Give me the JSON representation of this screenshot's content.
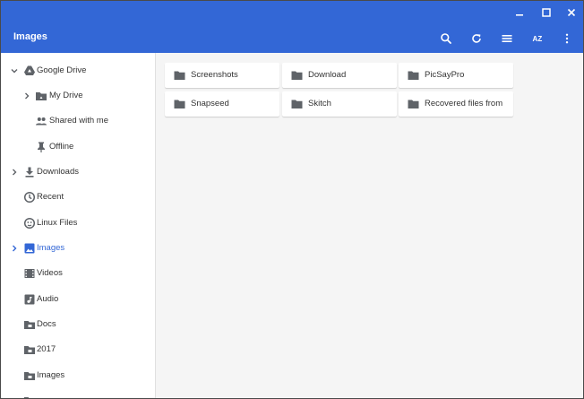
{
  "window": {
    "controls": [
      "minimize-icon",
      "maximize-icon",
      "close-icon"
    ]
  },
  "appbar": {
    "title": "Images",
    "tools": [
      "search-icon",
      "refresh-icon",
      "list-view-icon",
      "sort-az-icon",
      "more-vert-icon"
    ],
    "sort_label": "AZ"
  },
  "sidebar": {
    "items": [
      {
        "label": "Google Drive",
        "icon": "google-drive-icon",
        "chevron": "down"
      },
      {
        "label": "My Drive",
        "icon": "my-drive-icon",
        "chevron": "right"
      },
      {
        "label": "Shared with me",
        "icon": "shared-people-icon",
        "chevron": ""
      },
      {
        "label": "Offline",
        "icon": "pin-icon",
        "chevron": ""
      },
      {
        "label": "Downloads",
        "icon": "download-icon",
        "chevron": "right"
      },
      {
        "label": "Recent",
        "icon": "clock-icon",
        "chevron": ""
      },
      {
        "label": "Linux Files",
        "icon": "linux-icon",
        "chevron": ""
      },
      {
        "label": "Images",
        "icon": "image-icon",
        "chevron": "right",
        "active": true
      },
      {
        "label": "Videos",
        "icon": "video-icon",
        "chevron": ""
      },
      {
        "label": "Audio",
        "icon": "audio-icon",
        "chevron": ""
      },
      {
        "label": "Docs",
        "icon": "folder-icon",
        "chevron": ""
      },
      {
        "label": "2017",
        "icon": "folder-icon",
        "chevron": ""
      },
      {
        "label": "Images",
        "icon": "folder-icon",
        "chevron": ""
      }
    ]
  },
  "folders": [
    {
      "label": "Screenshots"
    },
    {
      "label": "Download"
    },
    {
      "label": "PicSayPro"
    },
    {
      "label": "Snapseed"
    },
    {
      "label": "Skitch"
    },
    {
      "label": "Recovered files from"
    }
  ],
  "colors": {
    "accent": "#3367d6",
    "icon_gray": "#5f6368",
    "folder_icon": "#5f6368",
    "active_text": "#3367d6"
  }
}
